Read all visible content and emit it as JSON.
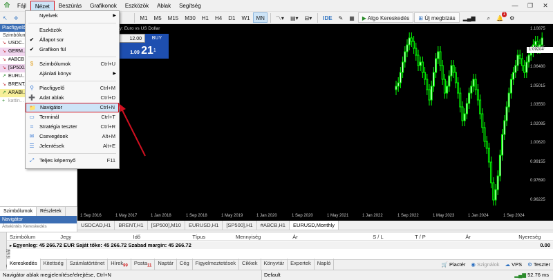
{
  "menubar": {
    "items": [
      "Fájl",
      "Nézet",
      "Beszúrás",
      "Grafikonok",
      "Eszközök",
      "Ablak",
      "Segítség"
    ],
    "active": "Nézet"
  },
  "toolbar": {
    "timeframes": [
      "M1",
      "M5",
      "M15",
      "M30",
      "H1",
      "H4",
      "D1",
      "W1",
      "MN"
    ],
    "selected": "MN",
    "ide": "IDE",
    "algo": "Algo Kereskedés",
    "new_order": "Új megbízás",
    "notif_count": "1"
  },
  "leftpanel": {
    "title": "Piacfigyelő",
    "header": "Szimbólum",
    "symbols": [
      {
        "name": "USDC...",
        "dir": "down",
        "style": "none"
      },
      {
        "name": "GERM...",
        "dir": "down",
        "style": "pink"
      },
      {
        "name": "#ABCB",
        "dir": "down",
        "style": "none"
      },
      {
        "name": "[SP500...",
        "dir": "down",
        "style": "pink"
      },
      {
        "name": "EURU...",
        "dir": "up",
        "style": "none"
      },
      {
        "name": "BRENT...",
        "dir": "down",
        "style": "none"
      },
      {
        "name": "ARABI...",
        "dir": "up",
        "style": "yellow"
      },
      {
        "name": "kattin...",
        "dir": "plus",
        "style": "none"
      }
    ],
    "tabs": [
      "Szimbólumok",
      "Részletek"
    ]
  },
  "navigator": {
    "title": "Navigátor",
    "tabs": "Áttekintés   Kereskedés"
  },
  "menu": {
    "items": [
      {
        "label": "Nyelvek",
        "shortcut": "",
        "submenu": true,
        "icon": ""
      },
      {
        "sep": true
      },
      {
        "label": "Eszközök",
        "shortcut": "",
        "icon": ""
      },
      {
        "label": "Állapot sor",
        "shortcut": "",
        "icon": "check"
      },
      {
        "label": "Grafikon fül",
        "shortcut": "",
        "icon": "check"
      },
      {
        "sep": true
      },
      {
        "label": "Szimbólumok",
        "shortcut": "Ctrl+U",
        "icon": "symbols"
      },
      {
        "label": "Ajánlati könyv",
        "shortcut": "",
        "submenu": true,
        "icon": ""
      },
      {
        "sep": true
      },
      {
        "label": "Piacfigyelő",
        "shortcut": "Ctrl+M",
        "icon": "watch"
      },
      {
        "label": "Adat ablak",
        "shortcut": "Ctrl+D",
        "icon": "data"
      },
      {
        "label": "Navigátor",
        "shortcut": "Ctrl+N",
        "icon": "folder",
        "highlight": true
      },
      {
        "label": "Terminál",
        "shortcut": "Ctrl+T",
        "icon": "terminal"
      },
      {
        "label": "Stratégia teszter",
        "shortcut": "Ctrl+R",
        "icon": "tester"
      },
      {
        "label": "Csevegések",
        "shortcut": "Alt+M",
        "icon": "chat"
      },
      {
        "label": "Jelentések",
        "shortcut": "Alt+E",
        "icon": "report"
      },
      {
        "sep": true
      },
      {
        "label": "Teljes képernyő",
        "shortcut": "F11",
        "icon": "fullscreen"
      }
    ]
  },
  "chart": {
    "title": "thly:  Euro vs US Dollar",
    "lot": "12.00",
    "buy": "BUY",
    "price_small": "1.09",
    "price_big": "21",
    "price_sup": "1",
    "current_price": "1.09204",
    "y_labels": [
      "1.10875",
      "1.07945",
      "1.06480",
      "1.05015",
      "1.03550",
      "1.02085",
      "1.00620",
      "0.99155",
      "0.97690",
      "0.96225"
    ],
    "x_labels": [
      "1 Sep 2016",
      "1 May 2017",
      "1 Jan 2018",
      "1 Sep 2018",
      "1 May 2019",
      "1 Jan 2020",
      "1 Sep 2020",
      "1 May 2021",
      "1 Jan 2022",
      "1 Sep 2022",
      "1 May 2023",
      "1 Jan 2024",
      "1 Sep 2024"
    ]
  },
  "chart_tabs": {
    "items": [
      "USDCAD,H1",
      "BRENT,H1",
      "[SP500],M10",
      "EURUSD,H1",
      "[SP500],H1",
      "#ABCB,H1",
      "EURUSD,Monthly"
    ],
    "active": "EURUSD,Monthly"
  },
  "toolbox": {
    "side": "Terminál",
    "columns": [
      "Szimbólum",
      "Jegy",
      "Idő",
      "Típus",
      "Mennyiség",
      "Ár",
      "S / L",
      "T / P",
      "Ár",
      "Nyereség"
    ],
    "summary": "Egyenleg: 45 266.72 EUR  Saját tőke: 45 266.72  Szabad margin: 45 266.72",
    "summary_val": "0.00",
    "tabs": [
      {
        "label": "Kereskedés",
        "badge": ""
      },
      {
        "label": "Kitettség",
        "badge": ""
      },
      {
        "label": "Számlatörténet",
        "badge": ""
      },
      {
        "label": "Hírek",
        "badge": "99"
      },
      {
        "label": "Posta",
        "badge": "11"
      },
      {
        "label": "Naptár",
        "badge": ""
      },
      {
        "label": "Cég",
        "badge": ""
      },
      {
        "label": "Figyelmeztetések",
        "badge": ""
      },
      {
        "label": "Cikkek",
        "badge": ""
      },
      {
        "label": "Könyvtár",
        "badge": ""
      },
      {
        "label": "Expertek",
        "badge": ""
      },
      {
        "label": "Napló",
        "badge": ""
      }
    ],
    "right": [
      "Piactér",
      "Szignálok",
      "VPS",
      "Teszter"
    ]
  },
  "status": {
    "left": "Navigátor ablak megjelenítése/elrejtése, Ctrl+N",
    "mid": "Default",
    "right": "52.76 ms"
  }
}
